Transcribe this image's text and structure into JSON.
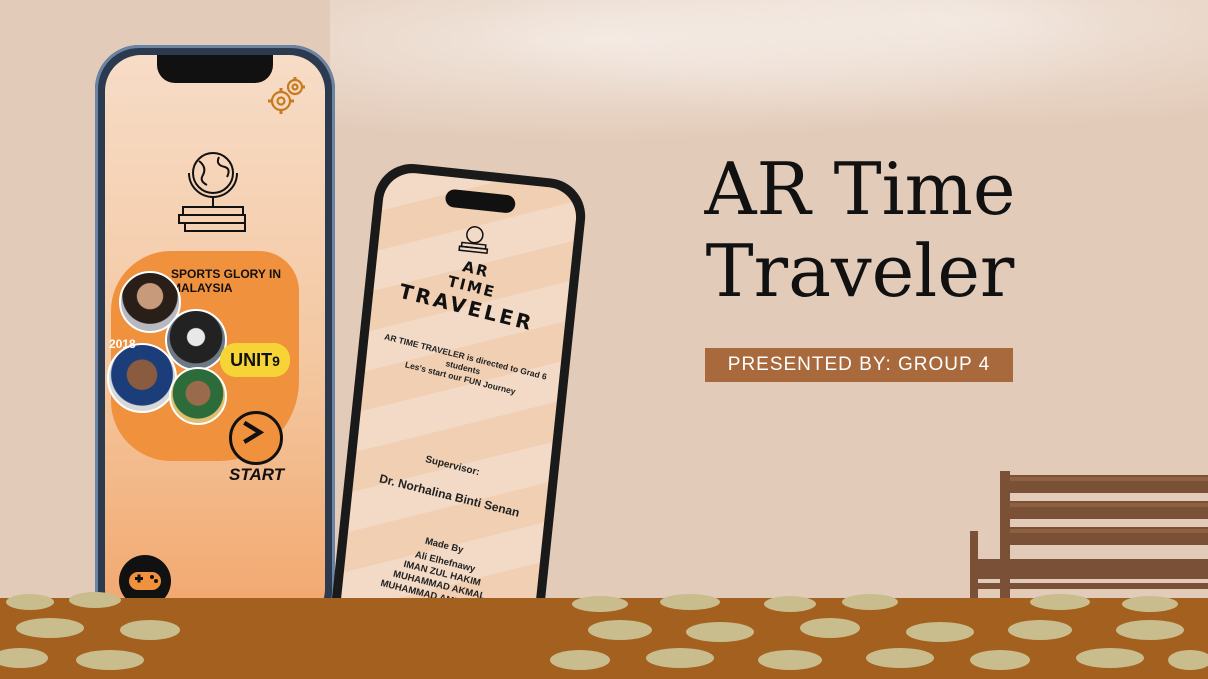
{
  "slide": {
    "title_line1": "AR Time",
    "title_line2": "Traveler",
    "presented_by": "PRESENTED BY: GROUP 4"
  },
  "phone_home": {
    "heading": "SPORTS GLORY IN MALAYSIA",
    "badge_year": "2018",
    "unit_label": "UNIT",
    "unit_number": "9",
    "start_label": "START"
  },
  "phone_about": {
    "brand_line1": "AR",
    "brand_line2": "TIME",
    "brand_line3": "TRAVELER",
    "intro_line1": "AR TIME TRAVELER is directed to Grad 6",
    "intro_line2": "students",
    "intro_line3": "Les's start our FUN Journey",
    "supervisor_label": "Supervisor:",
    "supervisor_name": "Dr. Norhalina Binti Senan",
    "made_by_label": "Made By",
    "members": [
      "Ali Elhefnawy",
      "IMAN ZUL HAKIM",
      "MUHAMMAD AKMAL",
      "MUHAMMAD AMIRUDDIN"
    ]
  },
  "colors": {
    "background": "#e3cbb9",
    "accent_orange": "#f0913e",
    "badge_brown": "#a86a3c",
    "unit_yellow": "#f7d436"
  },
  "icons": [
    "gear-icon",
    "globe-books-icon",
    "play-arrow-icon",
    "gamepad-icon"
  ]
}
